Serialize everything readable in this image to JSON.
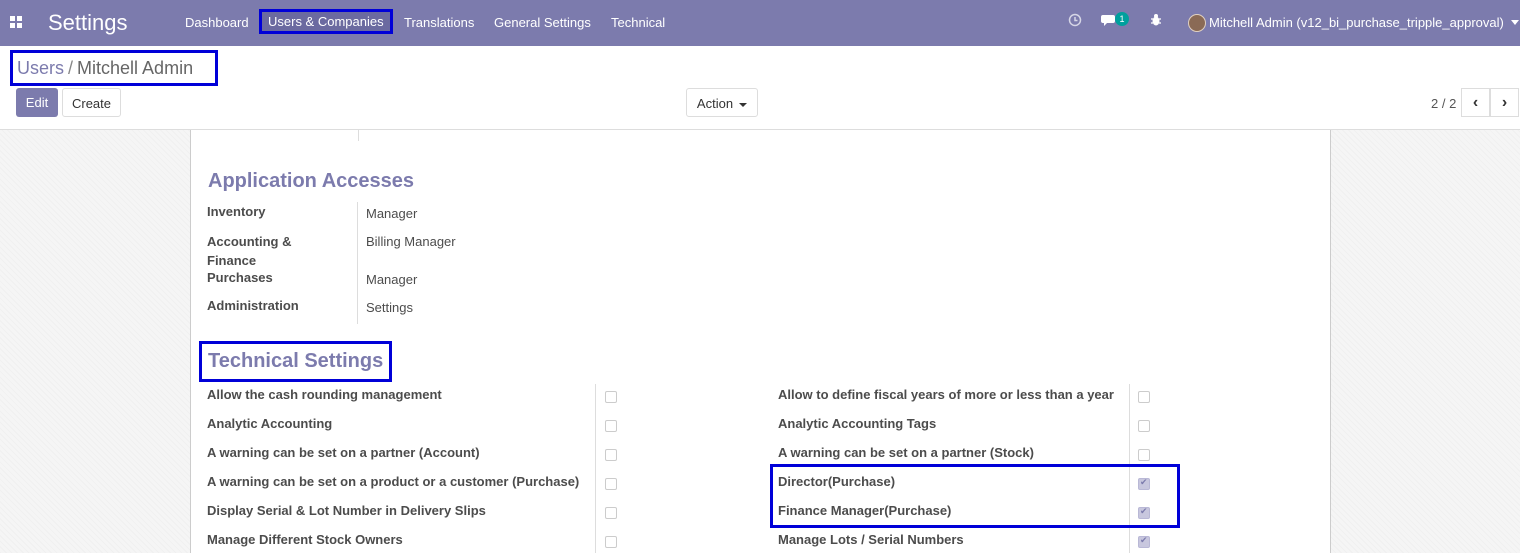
{
  "navbar": {
    "brand": "Settings",
    "menu": [
      "Dashboard",
      "Users & Companies",
      "Translations",
      "General Settings",
      "Technical"
    ],
    "active_menu": "Users & Companies",
    "chat_badge": "1",
    "user": "Mitchell Admin (v12_bi_purchase_tripple_approval)",
    "icons": [
      "apps-icon",
      "clock-icon",
      "chat-icon",
      "bug-icon",
      "avatar"
    ]
  },
  "breadcrumb": {
    "parent": "Users",
    "separator": "/",
    "current": "Mitchell Admin"
  },
  "buttons": {
    "edit": "Edit",
    "create": "Create",
    "action": "Action"
  },
  "pager": {
    "value": "2 / 2"
  },
  "sections": {
    "application_accesses": {
      "title": "Application Accesses",
      "rows": [
        {
          "label": "Inventory",
          "value": "Manager"
        },
        {
          "label": "Accounting &\nFinance",
          "value": "Billing Manager"
        },
        {
          "label": "Purchases",
          "value": "Manager"
        },
        {
          "label": "Administration",
          "value": "Settings"
        }
      ]
    },
    "technical_settings": {
      "title": "Technical Settings",
      "left": [
        {
          "label": "Allow the cash rounding management",
          "checked": false
        },
        {
          "label": "Analytic Accounting",
          "checked": false
        },
        {
          "label": "A warning can be set on a partner (Account)",
          "checked": false
        },
        {
          "label": "A warning can be set on a product or a customer (Purchase)",
          "checked": false
        },
        {
          "label": "Display Serial & Lot Number in Delivery Slips",
          "checked": false
        },
        {
          "label": "Manage Different Stock Owners",
          "checked": false
        }
      ],
      "right": [
        {
          "label": "Allow to define fiscal years of more or less than a year",
          "checked": false
        },
        {
          "label": "Analytic Accounting Tags",
          "checked": false
        },
        {
          "label": "A warning can be set on a partner (Stock)",
          "checked": false
        },
        {
          "label": "Director(Purchase)",
          "checked": true
        },
        {
          "label": "Finance Manager(Purchase)",
          "checked": true
        },
        {
          "label": "Manage Lots / Serial Numbers",
          "checked": true
        }
      ]
    }
  },
  "colors": {
    "brand": "#7c7bad",
    "highlight": "#0000d8"
  }
}
